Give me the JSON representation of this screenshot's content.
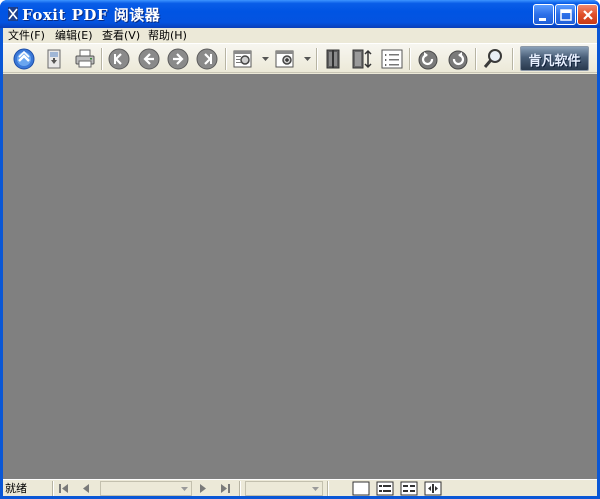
{
  "window": {
    "title": "Foxit PDF 阅读器"
  },
  "menu": [
    {
      "label": "文件(F)"
    },
    {
      "label": "编辑(E)"
    },
    {
      "label": "查看(V)"
    },
    {
      "label": "帮助(H)"
    }
  ],
  "toolbar": {
    "logo_text": "肯凡软件",
    "icons": [
      "up-arrow-icon",
      "save-icon",
      "print-icon",
      "first-page-icon",
      "previous-page-icon",
      "next-page-icon",
      "last-page-icon",
      "zoom-fit-icon",
      "zoom-actual-icon",
      "single-page-icon",
      "continuous-page-icon",
      "outline-icon",
      "rotate-left-icon",
      "rotate-right-icon",
      "search-icon"
    ]
  },
  "status": {
    "text": "就绪",
    "page_value": "",
    "zoom_value": ""
  },
  "colors": {
    "titlebar": "#0054e3",
    "chrome": "#ece9d8",
    "document_background": "#808080",
    "close_button": "#e0502a"
  }
}
